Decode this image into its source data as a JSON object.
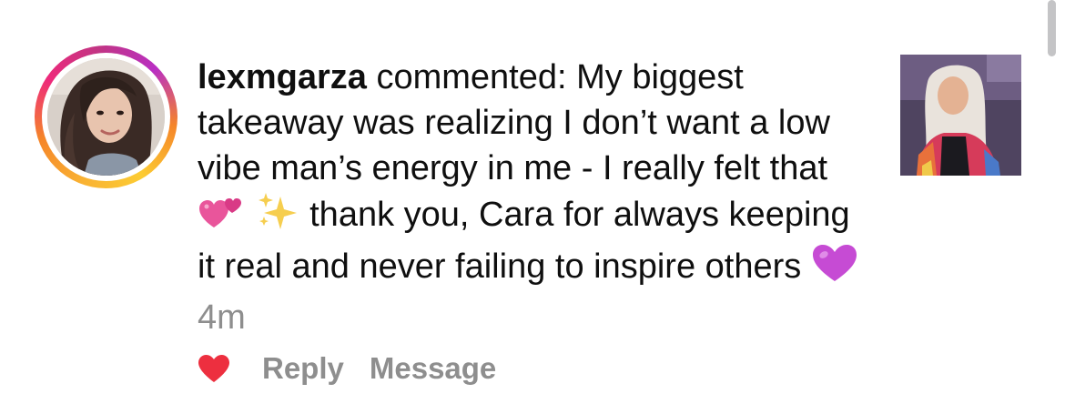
{
  "comment": {
    "username": "lexmgarza",
    "verb": "commented:",
    "segments": {
      "part1": "My biggest takeaway was realizing I don’t want a low vibe man’s energy in me - I really felt that",
      "part2": "thank you, Cara for always keeping it real and never failing to inspire others"
    },
    "emojis": {
      "two_hearts": "💕",
      "sparkles": "✨",
      "purple_heart": "💜"
    },
    "timestamp": "4m"
  },
  "actions": {
    "reply_label": "Reply",
    "message_label": "Message",
    "like_icon": "heart-filled",
    "like_color": "#ed4956"
  },
  "colors": {
    "text": "#0f0f0f",
    "secondary": "#8e8e8e",
    "story_ring": [
      "#f9b233",
      "#f58529",
      "#ee2a7b",
      "#c13584",
      "#b92fc3"
    ]
  }
}
